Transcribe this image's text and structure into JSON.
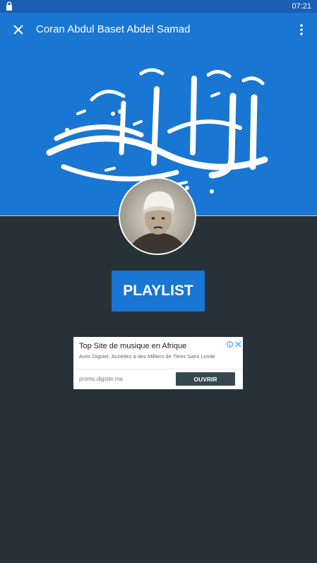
{
  "status_bar": {
    "time": "07:21",
    "left_icon": "lock-icon"
  },
  "app_bar": {
    "title": "Coran Abdul Baset Abdel Samad",
    "close_icon": "close-icon",
    "menu_icon": "more-vert-icon"
  },
  "header": {
    "artwork": "quran-calligraphy-image",
    "background": "#1976d2"
  },
  "avatar": {
    "image": "reciter-portrait"
  },
  "playlist": {
    "label": "PLAYLIST"
  },
  "ad": {
    "title": "Top Site de musique en Afrique",
    "description": "Avec Digster, Accédez à des Milliers de Titres Sans Limite",
    "url": "promo.digster.ma",
    "cta": "OUVRIR"
  },
  "colors": {
    "primary": "#1976d2",
    "background": "#263238",
    "cta": "#37474f"
  }
}
